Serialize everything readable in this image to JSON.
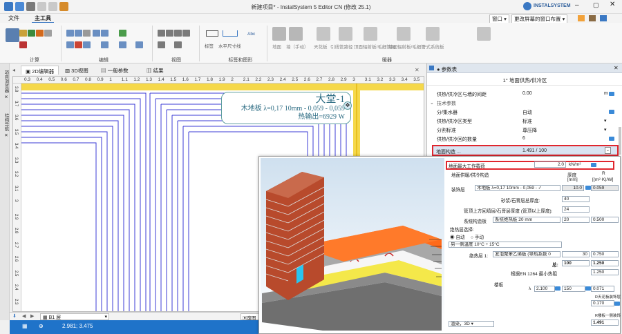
{
  "window": {
    "title": "新建项目* - InstalSystem 5 Editor CN (修改 25.1)",
    "brand": "INSTALSYSTEM",
    "window_menu": "窗口",
    "layout_dropdown": "更改屏幕的窗口布置"
  },
  "menu": {
    "file": "文件",
    "main_tools": "主工具"
  },
  "ribbon": {
    "group_calc": "计算",
    "group_edit": "编辑",
    "group_view": "视图",
    "group_labels": "标签和图形",
    "group_radiator": "暖器",
    "label_tag": "标签",
    "label_dim": "水平尺寸线",
    "abc": "Abc",
    "floor_tools": [
      "地面",
      "墙（手动）",
      "天花板",
      "引线管路径",
      "顶面辐射板/毛细管网",
      "墙面辐射板/毛细管",
      "干式系统板"
    ]
  },
  "left_tabs": [
    "项目浏览器 ✕",
    "结构导航 ✕"
  ],
  "doc_tabs": {
    "editor2d": "2D编辑器",
    "view3d": "3D视图",
    "general_params": "一般参数",
    "results": "结果"
  },
  "ruler": {
    "h": [
      "0.3",
      "0.4",
      "0.5",
      "0.6",
      "0.7",
      "0.8",
      "0.9",
      "1",
      "1.1",
      "1.2",
      "1.3",
      "1.4",
      "1.5",
      "1.6",
      "1.7",
      "1.8",
      "1.9",
      "2",
      "2.1",
      "2.2",
      "2.3",
      "2.4",
      "2.5",
      "2.6",
      "2.7",
      "2.8",
      "2.9",
      "3",
      "3.1",
      "3.2",
      "3.3",
      "3.4",
      "3.5"
    ],
    "v": [
      "3.8",
      "3.7",
      "3.6",
      "3.5",
      "3.4",
      "3.3",
      "3.2",
      "3.1",
      "3",
      "2.9",
      "2.8",
      "2.7",
      "2.6",
      "2.5",
      "2.4",
      "2.3"
    ]
  },
  "room": {
    "name": "大堂-1",
    "floor": "木地板 λ=0,17 10mm - 0,059 - 0,059",
    "heat": "热输出=6929 W"
  },
  "status": {
    "level": "B1 层",
    "coords": "2.981; 3.475",
    "plan": "废图"
  },
  "panel": {
    "title": "● 参数表",
    "subtitle": "1° 地面供热/供冷区",
    "rows": [
      {
        "k": "供热/供冷区与墙的间距",
        "v": "0.00",
        "u": "m"
      },
      {
        "k": "技术参数",
        "v": "",
        "u": "",
        "section": true
      },
      {
        "k": "分/集水器",
        "v": "自动",
        "u": ""
      },
      {
        "k": "供热/供冷区类型",
        "v": "标准",
        "u": ""
      },
      {
        "k": "分割标准",
        "v": "尊压降",
        "u": ""
      },
      {
        "k": "供热/供冷回的数量",
        "v": "6",
        "u": ""
      },
      {
        "k": "地面构造 ...",
        "v": "1.491 / 100",
        "u": "",
        "highlight": true
      }
    ]
  },
  "dialog": {
    "max_load_label": "地面最大工作载荷",
    "max_load_value": "2.0",
    "max_load_unit": "kN/m²",
    "construction_label": "地面供暖/供冷构造",
    "col_thickness": "厚度",
    "col_thickness_unit": "[mm]",
    "col_r": "R",
    "col_r_unit": "[(m²·K)/W]",
    "finish_label": "装饰层",
    "finish_value": "木地板 λ=0,17 10mm - 0,059 - ✓",
    "finish_thk": "10.0",
    "finish_r": "0.059",
    "screed_total_label": "砂浆/石膏层总厚度:",
    "screed_total": "40",
    "pipe_above_label": "管顶上方回填层/石膏层厚度 (管顶以上厚度):",
    "pipe_above": "24",
    "system_plate_label": "系统构造板",
    "system_plate": "系统绝热板 20 mm",
    "system_plate_thk": "20",
    "system_plate_r": "0.500",
    "insul_select_label": "绝热层选择:",
    "radio_auto": "自动",
    "radio_manual": "手动",
    "other_temp": "另一侧温度 10°C ÷ 15°C",
    "insul1_label": "绝热层 1:",
    "insul1": "发泡聚苯乙烯板 (导热系数 0",
    "insul1_thk": "30",
    "insul1_r": "0.750",
    "total_label": "总:",
    "total_thk": "100",
    "total_r": "1.250",
    "standard_label": "根据EN 1264 最小热阻",
    "standard_r": "1.250",
    "slab_label": "楼板",
    "lambda_label": "λ",
    "slab_lambda": "2.100",
    "slab_thk": "150",
    "slab_r": "0.071",
    "r_ceiling_label": "R天花板装饰层",
    "r_ceiling": "0.170",
    "r_floor_label": "R楼板一侧装饰",
    "r_total": "1.491",
    "render_mode": "渲染，3D"
  },
  "colors": {
    "accent": "#1f73c9",
    "highlight": "#e0262e",
    "floor_orange": "#ff6a1a",
    "brick": "#b84a2c"
  }
}
